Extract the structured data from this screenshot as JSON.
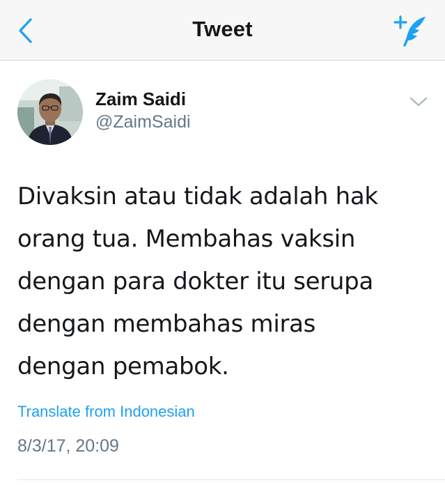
{
  "nav": {
    "title": "Tweet"
  },
  "tweet": {
    "author_name": "Zaim Saidi",
    "author_handle": "@ZaimSaidi",
    "text_lines": [
      "Divaksin atau tidak adalah hak",
      "orang tua. Membahas vaksin",
      "dengan para dokter itu serupa",
      "dengan membahas miras",
      "dengan pemabok."
    ],
    "translate_label": "Translate from Indonesian",
    "timestamp": "8/3/17, 20:09"
  },
  "icons": {
    "back": "chevron-left-icon",
    "compose": "compose-tweet-icon",
    "more": "chevron-down-icon"
  },
  "colors": {
    "accent": "#1da1f2",
    "secondary_text": "#657786",
    "primary_text": "#14171a",
    "nav_background": "#f7f7f7"
  }
}
